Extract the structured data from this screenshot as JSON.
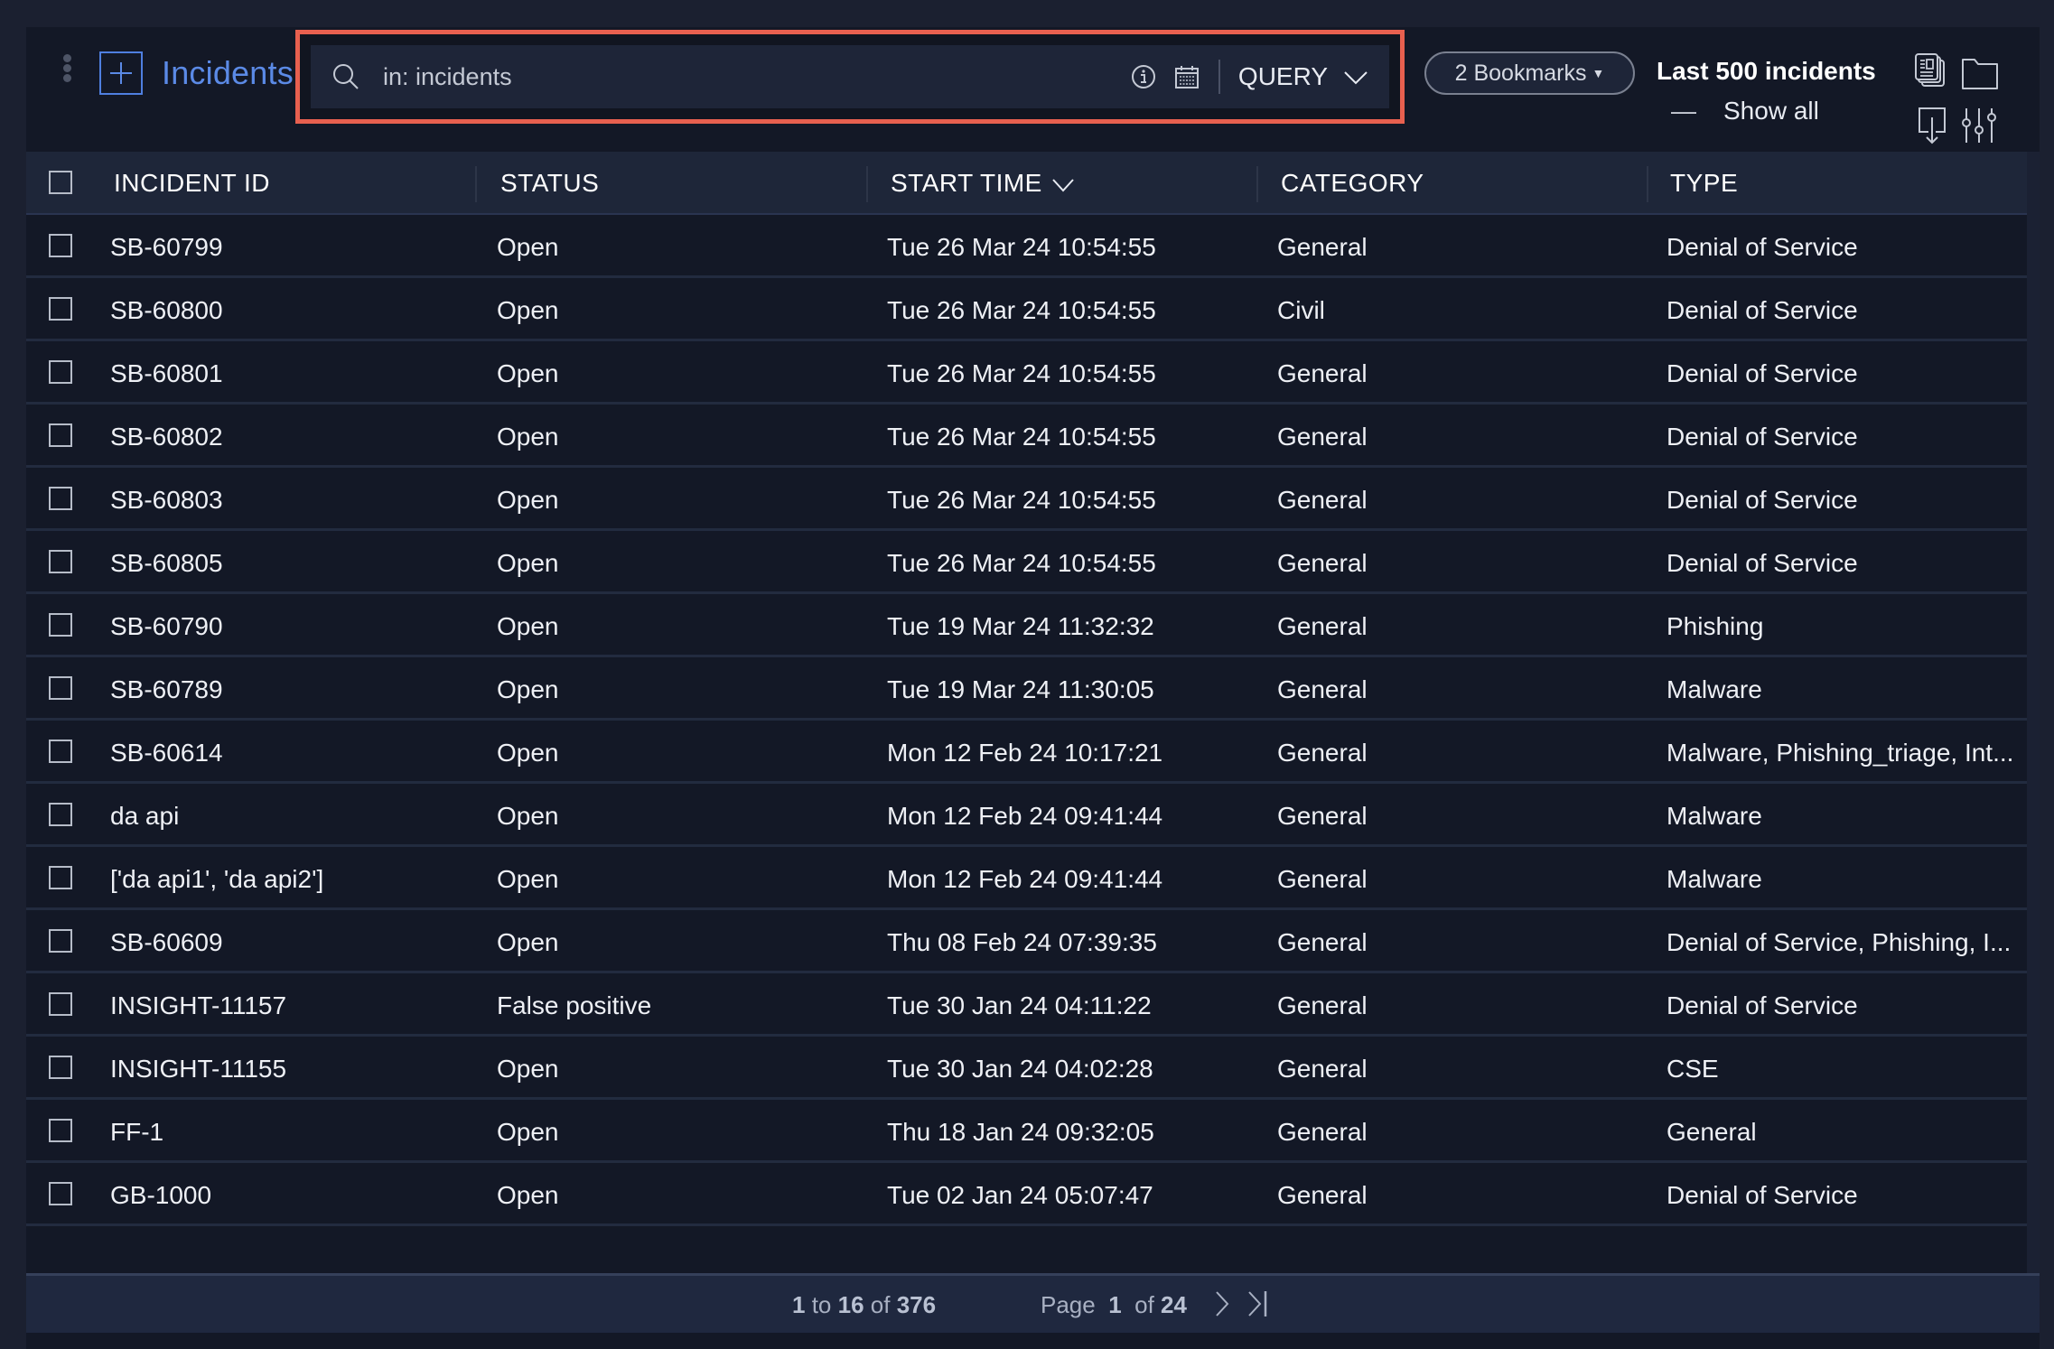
{
  "header": {
    "title": "Incidents",
    "search": {
      "value": "in: incidents",
      "placeholder": "",
      "mode_label": "QUERY"
    },
    "bookmarks_label": "2 Bookmarks",
    "scope_label": "Last 500 incidents",
    "show_all_dash": "—",
    "show_all_label": "Show all",
    "icons": [
      "kebab-menu-icon",
      "add-icon",
      "search-icon",
      "info-icon",
      "calendar-icon",
      "chevron-down-icon",
      "documents-icon",
      "folder-icon",
      "export-icon",
      "column-settings-icon"
    ]
  },
  "table": {
    "columns": [
      "INCIDENT ID",
      "STATUS",
      "START TIME",
      "CATEGORY",
      "TYPE"
    ],
    "sorted_column": "START TIME",
    "rows": [
      {
        "id": "SB-60799",
        "status": "Open",
        "start_time": "Tue 26 Mar 24 10:54:55",
        "category": "General",
        "type": "Denial of Service"
      },
      {
        "id": "SB-60800",
        "status": "Open",
        "start_time": "Tue 26 Mar 24 10:54:55",
        "category": "Civil",
        "type": "Denial of Service"
      },
      {
        "id": "SB-60801",
        "status": "Open",
        "start_time": "Tue 26 Mar 24 10:54:55",
        "category": "General",
        "type": "Denial of Service"
      },
      {
        "id": "SB-60802",
        "status": "Open",
        "start_time": "Tue 26 Mar 24 10:54:55",
        "category": "General",
        "type": "Denial of Service"
      },
      {
        "id": "SB-60803",
        "status": "Open",
        "start_time": "Tue 26 Mar 24 10:54:55",
        "category": "General",
        "type": "Denial of Service"
      },
      {
        "id": "SB-60805",
        "status": "Open",
        "start_time": "Tue 26 Mar 24 10:54:55",
        "category": "General",
        "type": "Denial of Service"
      },
      {
        "id": "SB-60790",
        "status": "Open",
        "start_time": "Tue 19 Mar 24 11:32:32",
        "category": "General",
        "type": "Phishing"
      },
      {
        "id": "SB-60789",
        "status": "Open",
        "start_time": "Tue 19 Mar 24 11:30:05",
        "category": "General",
        "type": "Malware"
      },
      {
        "id": "SB-60614",
        "status": "Open",
        "start_time": "Mon 12 Feb 24 10:17:21",
        "category": "General",
        "type": "Malware, Phishing_triage, Int..."
      },
      {
        "id": "da api",
        "status": "Open",
        "start_time": "Mon 12 Feb 24 09:41:44",
        "category": "General",
        "type": "Malware"
      },
      {
        "id": "['da api1', 'da api2']",
        "status": "Open",
        "start_time": "Mon 12 Feb 24 09:41:44",
        "category": "General",
        "type": "Malware"
      },
      {
        "id": "SB-60609",
        "status": "Open",
        "start_time": "Thu 08 Feb 24 07:39:35",
        "category": "General",
        "type": "Denial of Service, Phishing, I..."
      },
      {
        "id": "INSIGHT-11157",
        "status": "False positive",
        "start_time": "Tue 30 Jan 24 04:11:22",
        "category": "General",
        "type": "Denial of Service"
      },
      {
        "id": "INSIGHT-11155",
        "status": "Open",
        "start_time": "Tue 30 Jan 24 04:02:28",
        "category": "General",
        "type": "CSE"
      },
      {
        "id": "FF-1",
        "status": "Open",
        "start_time": "Thu 18 Jan 24 09:32:05",
        "category": "General",
        "type": "General"
      },
      {
        "id": "GB-1000",
        "status": "Open",
        "start_time": "Tue 02 Jan 24 05:07:47",
        "category": "General",
        "type": "Denial of Service"
      }
    ]
  },
  "pagination": {
    "from": "1",
    "to_word": "to",
    "to": "16",
    "of_word": "of",
    "total": "376",
    "page_word": "Page",
    "page": "1",
    "page_of_word": "of",
    "page_total": "24"
  },
  "colors": {
    "accent": "#5b8ae6",
    "highlight_border": "#e8604f",
    "background": "#131826",
    "header_row": "#1e2639"
  }
}
